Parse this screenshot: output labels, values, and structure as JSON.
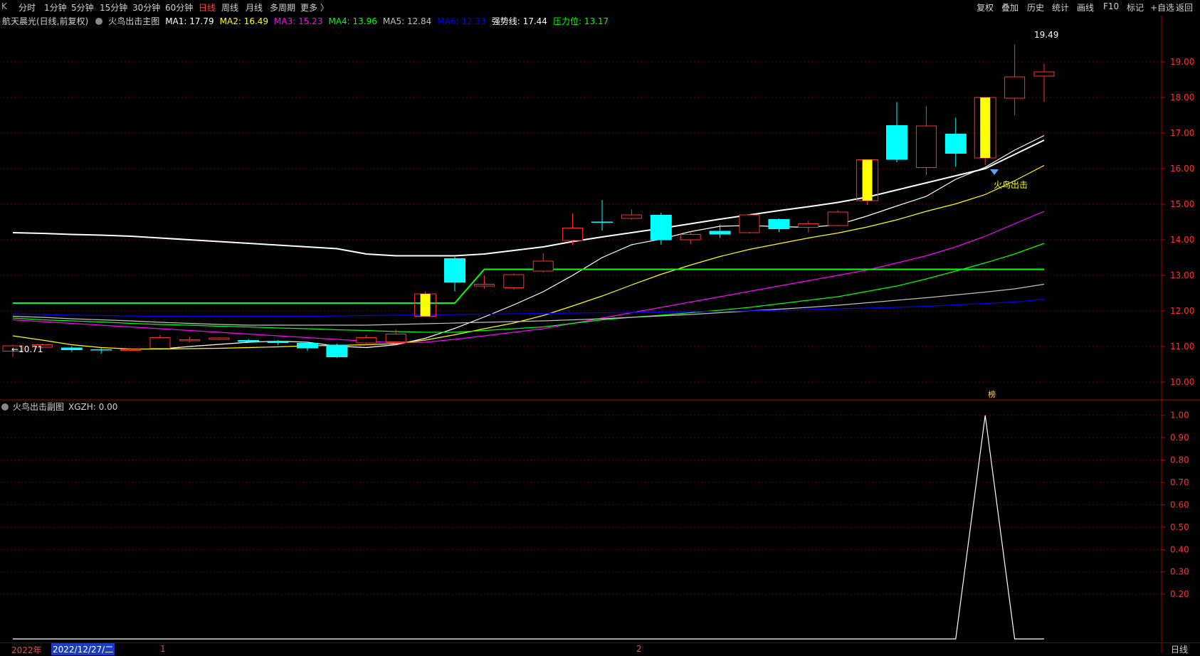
{
  "toolbar": {
    "logo": "K",
    "periods": [
      "分时",
      "1分钟",
      "5分钟",
      "15分钟",
      "30分钟",
      "60分钟",
      "日线",
      "周线",
      "月线",
      "多周期",
      "更多 〉"
    ],
    "active_period": "日线",
    "right_items": [
      "复权",
      "叠加",
      "历史",
      "统计",
      "画线",
      "F10",
      "标记",
      "+自选",
      "返回"
    ]
  },
  "main_legend": {
    "stock": "航天晨光(日线,前复权)",
    "indicator": "火鸟出击主图",
    "items": [
      {
        "label": "MA1: 17.79",
        "color": "#ffffff"
      },
      {
        "label": "MA2: 16.49",
        "color": "#ffff00"
      },
      {
        "label": "MA3: 15.23",
        "color": "#ff00ff"
      },
      {
        "label": "MA4: 13.96",
        "color": "#00ff00"
      },
      {
        "label": "MA5: 12.84",
        "color": "#c0c0c0"
      },
      {
        "label": "MA6: 12.33",
        "color": "#0000ff"
      },
      {
        "label": "强势线: 17.44",
        "color": "#ffffff"
      },
      {
        "label": "压力位: 13.17",
        "color": "#00ff00"
      }
    ]
  },
  "sub_legend": {
    "indicator": "火鸟出击副图",
    "value": "XGZH: 0.00"
  },
  "annotations": {
    "high": "19.49",
    "low": "←10.71",
    "signal": "火鸟出击",
    "flag": "榜"
  },
  "bottom_bar": {
    "year": "2022年",
    "date": "2022/12/27/二",
    "month1": "1",
    "month2": "2",
    "period_label": "日线"
  },
  "colors": {
    "up": "#ff3030",
    "down": "#00ffff",
    "grid": "#6a0000",
    "axis": "#b00000",
    "special": "#ffff00"
  },
  "chart_data": [
    {
      "type": "candlestick",
      "ylim": [
        9.5,
        19.9
      ],
      "yticks": [
        "19.00",
        "18.00",
        "17.00",
        "16.00",
        "15.00",
        "14.00",
        "13.00",
        "12.00",
        "11.00",
        "10.00"
      ],
      "candles": [
        {
          "o": 10.87,
          "c": 11.02,
          "h": 11.05,
          "l": 10.71
        },
        {
          "o": 10.98,
          "c": 11.05,
          "h": 11.08,
          "l": 10.95
        },
        {
          "o": 10.97,
          "c": 10.9,
          "h": 11.0,
          "l": 10.85
        },
        {
          "o": 10.92,
          "c": 10.91,
          "h": 10.97,
          "l": 10.8
        },
        {
          "o": 10.9,
          "c": 10.92,
          "h": 10.96,
          "l": 10.88
        },
        {
          "o": 10.95,
          "c": 11.25,
          "h": 11.32,
          "l": 10.95
        },
        {
          "o": 11.18,
          "c": 11.19,
          "h": 11.27,
          "l": 11.12
        },
        {
          "o": 11.2,
          "c": 11.24,
          "h": 11.26,
          "l": 11.18
        },
        {
          "o": 11.18,
          "c": 11.13,
          "h": 11.21,
          "l": 11.1
        },
        {
          "o": 11.16,
          "c": 11.1,
          "h": 11.18,
          "l": 11.05
        },
        {
          "o": 11.1,
          "c": 10.95,
          "h": 11.12,
          "l": 10.88
        },
        {
          "o": 11.05,
          "c": 10.7,
          "h": 11.08,
          "l": 10.68
        },
        {
          "o": 11.1,
          "c": 11.25,
          "h": 11.32,
          "l": 11.05
        },
        {
          "o": 11.13,
          "c": 11.35,
          "h": 11.48,
          "l": 11.1
        },
        {
          "o": 11.85,
          "c": 12.48,
          "h": 12.55,
          "l": 11.85,
          "special": true
        },
        {
          "o": 13.48,
          "c": 12.8,
          "h": 13.52,
          "l": 12.55
        },
        {
          "o": 12.7,
          "c": 12.75,
          "h": 13.0,
          "l": 12.62
        },
        {
          "o": 12.65,
          "c": 13.02,
          "h": 13.05,
          "l": 12.6
        },
        {
          "o": 13.12,
          "c": 13.4,
          "h": 13.62,
          "l": 13.08
        },
        {
          "o": 13.98,
          "c": 14.33,
          "h": 14.74,
          "l": 13.85
        },
        {
          "o": 14.51,
          "c": 14.49,
          "h": 15.12,
          "l": 14.26
        },
        {
          "o": 14.6,
          "c": 14.7,
          "h": 14.85,
          "l": 14.57
        },
        {
          "o": 14.7,
          "c": 13.99,
          "h": 14.76,
          "l": 13.86
        },
        {
          "o": 14.0,
          "c": 14.15,
          "h": 14.23,
          "l": 13.88
        },
        {
          "o": 14.25,
          "c": 14.15,
          "h": 14.43,
          "l": 14.05
        },
        {
          "o": 14.2,
          "c": 14.7,
          "h": 14.72,
          "l": 14.18
        },
        {
          "o": 14.58,
          "c": 14.3,
          "h": 14.6,
          "l": 14.22
        },
        {
          "o": 14.35,
          "c": 14.45,
          "h": 14.53,
          "l": 14.2
        },
        {
          "o": 14.4,
          "c": 14.78,
          "h": 14.83,
          "l": 14.38
        },
        {
          "o": 15.1,
          "c": 16.25,
          "h": 16.25,
          "l": 14.98,
          "special": true
        },
        {
          "o": 17.22,
          "c": 16.25,
          "h": 17.87,
          "l": 16.18
        },
        {
          "o": 16.03,
          "c": 17.2,
          "h": 17.75,
          "l": 15.82
        },
        {
          "o": 16.98,
          "c": 16.42,
          "h": 17.43,
          "l": 16.05
        },
        {
          "o": 16.3,
          "c": 18.0,
          "h": 18.0,
          "l": 16.1,
          "special": true
        },
        {
          "o": 17.98,
          "c": 18.58,
          "h": 19.49,
          "l": 17.5
        },
        {
          "o": 18.6,
          "c": 18.72,
          "h": 18.95,
          "l": 17.88
        }
      ],
      "series": [
        {
          "label": "MA1",
          "color": "#ffffff",
          "values": [
            null,
            null,
            null,
            null,
            null,
            10.93,
            11.0,
            11.06,
            11.12,
            11.15,
            11.12,
            11.01,
            10.97,
            11.05,
            11.23,
            11.51,
            11.83,
            12.17,
            12.54,
            13.0,
            13.5,
            13.86,
            14.02,
            14.23,
            14.38,
            14.4,
            14.37,
            14.35,
            14.42,
            14.67,
            14.95,
            15.22,
            15.7,
            16.04,
            16.52,
            16.93
          ]
        },
        {
          "label": "MA2",
          "color": "#ffff00",
          "values": [
            11.3,
            11.18,
            11.05,
            10.97,
            10.93,
            10.93,
            10.94,
            10.95,
            10.97,
            10.99,
            11.02,
            11.03,
            11.05,
            11.08,
            11.18,
            11.33,
            11.5,
            11.66,
            11.87,
            12.14,
            12.42,
            12.73,
            13.03,
            13.29,
            13.53,
            13.73,
            13.89,
            14.05,
            14.19,
            14.36,
            14.56,
            14.8,
            15.01,
            15.27,
            15.66,
            16.09
          ]
        },
        {
          "label": "MA3",
          "color": "#ff00ff",
          "values": [
            11.75,
            11.7,
            11.65,
            11.6,
            11.55,
            11.5,
            11.45,
            11.4,
            11.35,
            11.3,
            11.25,
            11.2,
            11.15,
            11.1,
            11.12,
            11.2,
            11.3,
            11.4,
            11.5,
            11.65,
            11.8,
            11.95,
            12.1,
            12.25,
            12.4,
            12.55,
            12.7,
            12.85,
            13.0,
            13.15,
            13.35,
            13.55,
            13.8,
            14.1,
            14.45,
            14.8
          ]
        },
        {
          "label": "MA4",
          "color": "#00ff00",
          "values": [
            11.8,
            11.75,
            11.72,
            11.69,
            11.65,
            11.62,
            11.6,
            11.57,
            11.55,
            11.52,
            11.5,
            11.47,
            11.45,
            11.42,
            11.4,
            11.4,
            11.45,
            11.5,
            11.55,
            11.65,
            11.75,
            11.82,
            11.88,
            11.95,
            12.02,
            12.1,
            12.2,
            12.3,
            12.4,
            12.55,
            12.7,
            12.9,
            13.12,
            13.35,
            13.6,
            13.9
          ]
        },
        {
          "label": "MA5",
          "color": "#c0c0c0",
          "values": [
            11.85,
            11.82,
            11.78,
            11.75,
            11.72,
            11.68,
            11.65,
            11.62,
            11.6,
            11.6,
            11.6,
            11.6,
            11.6,
            11.62,
            11.64,
            11.66,
            11.68,
            11.7,
            11.72,
            11.75,
            11.78,
            11.82,
            11.86,
            11.9,
            11.95,
            12.0,
            12.05,
            12.1,
            12.16,
            12.23,
            12.3,
            12.37,
            12.45,
            12.53,
            12.62,
            12.75
          ]
        },
        {
          "label": "MA6",
          "color": "#0000ff",
          "values": [
            11.92,
            11.9,
            11.88,
            11.87,
            11.86,
            11.85,
            11.85,
            11.85,
            11.85,
            11.85,
            11.85,
            11.86,
            11.87,
            11.88,
            11.89,
            11.9,
            11.91,
            11.92,
            11.93,
            11.94,
            11.95,
            11.96,
            11.97,
            11.98,
            11.99,
            12.0,
            12.02,
            12.04,
            12.06,
            12.08,
            12.1,
            12.13,
            12.17,
            12.21,
            12.25,
            12.33
          ]
        },
        {
          "label": "强势线",
          "color": "#ffffff",
          "values": [
            14.2,
            14.18,
            14.15,
            14.13,
            14.1,
            14.05,
            14.0,
            13.95,
            13.9,
            13.85,
            13.8,
            13.75,
            13.6,
            13.55,
            13.55,
            13.55,
            13.6,
            13.7,
            13.8,
            13.95,
            14.08,
            14.2,
            14.32,
            14.45,
            14.58,
            14.7,
            14.82,
            14.93,
            15.05,
            15.2,
            15.4,
            15.6,
            15.8,
            16.0,
            16.4,
            16.8
          ]
        },
        {
          "label": "压力位",
          "color": "#00ff00",
          "values": [
            12.22,
            12.22,
            12.22,
            12.22,
            12.22,
            12.22,
            12.22,
            12.22,
            12.22,
            12.22,
            12.22,
            12.22,
            12.22,
            12.22,
            12.22,
            12.22,
            13.17,
            13.17,
            13.17,
            13.17,
            13.17,
            13.17,
            13.17,
            13.17,
            13.17,
            13.17,
            13.17,
            13.17,
            13.17,
            13.17,
            13.17,
            13.17,
            13.17,
            13.17,
            13.17,
            13.17
          ]
        }
      ]
    },
    {
      "type": "line",
      "ylim": [
        0,
        1.05
      ],
      "yticks": [
        "1.00",
        "0.90",
        "0.80",
        "0.70",
        "0.60",
        "0.50",
        "0.40",
        "0.30",
        "0.20"
      ],
      "series": [
        {
          "label": "XGZH",
          "color": "#ffffff",
          "values": [
            0,
            0,
            0,
            0,
            0,
            0,
            0,
            0,
            0,
            0,
            0,
            0,
            0,
            0,
            0,
            0,
            0,
            0,
            0,
            0,
            0,
            0,
            0,
            0,
            0,
            0,
            0,
            0,
            0,
            0,
            0,
            0,
            0,
            1,
            0,
            0
          ]
        }
      ]
    }
  ]
}
